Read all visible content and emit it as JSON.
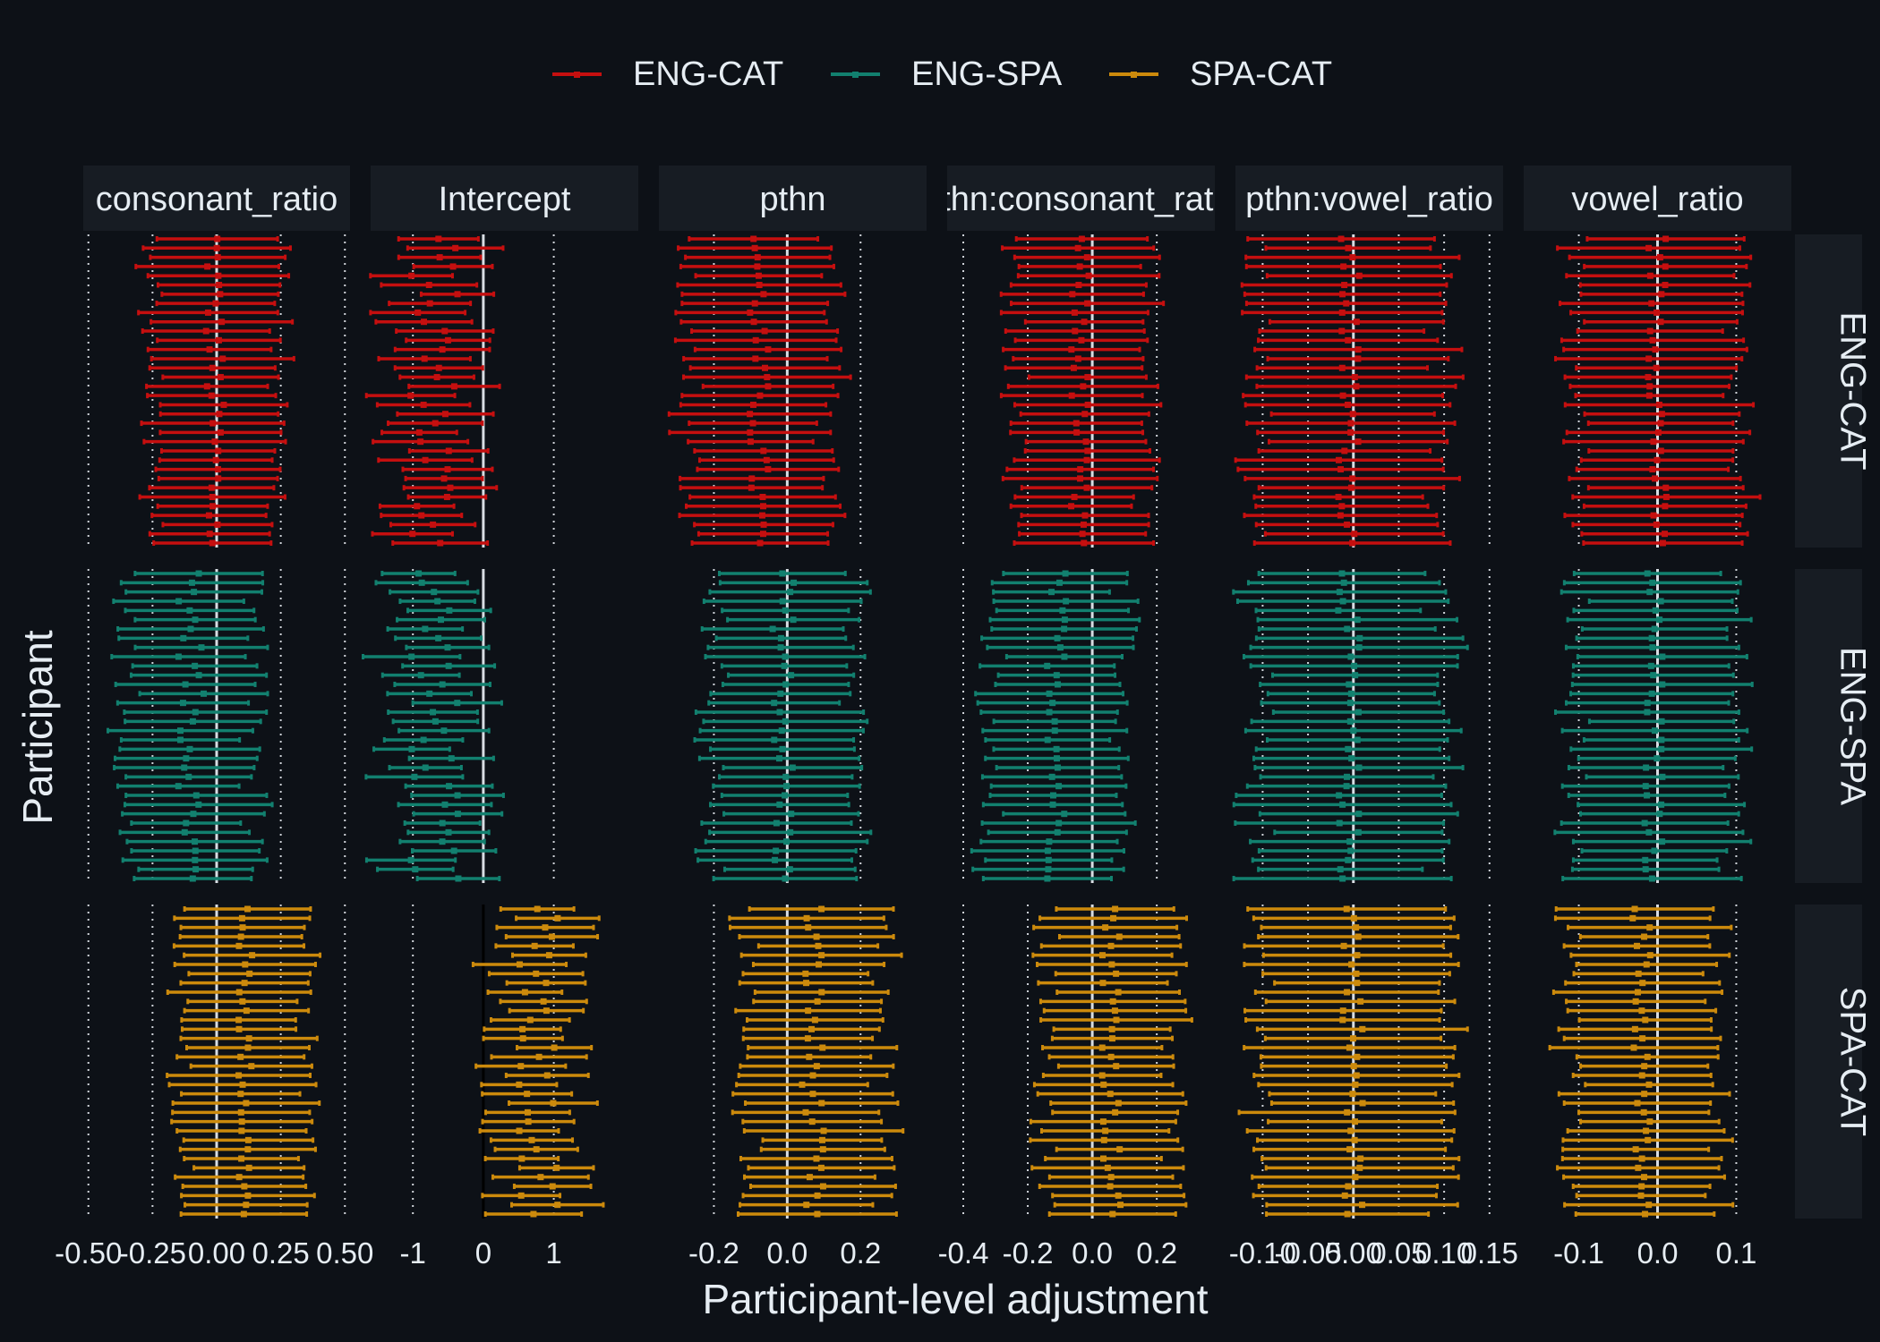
{
  "chart_data": {
    "type": "forest",
    "title": "",
    "xlabel": "Participant-level adjustment",
    "ylabel": "Participant",
    "legend": {
      "position": "top",
      "entries": [
        {
          "name": "ENG-CAT",
          "color": "#c50f0f"
        },
        {
          "name": "ENG-SPA",
          "color": "#12806f"
        },
        {
          "name": "SPA-CAT",
          "color": "#cc8a0c"
        }
      ]
    },
    "facet_columns": [
      {
        "label": "consonant_ratio",
        "xlim": [
          -0.52,
          0.52
        ],
        "ticks": [
          {
            "v": -0.5,
            "t": "-0.50"
          },
          {
            "v": -0.25,
            "t": "-0.25"
          },
          {
            "v": 0,
            "t": "0.00"
          },
          {
            "v": 0.25,
            "t": "0.25"
          },
          {
            "v": 0.5,
            "t": "0.50"
          }
        ],
        "rows": {
          "ENG-CAT": {
            "center": -0.01,
            "halfwidth": 0.25,
            "jitter": 0.04
          },
          "ENG-SPA": {
            "center": -0.1,
            "halfwidth": 0.25,
            "jitter": 0.05
          },
          "SPA-CAT": {
            "center": 0.11,
            "halfwidth": 0.25,
            "jitter": 0.03
          }
        }
      },
      {
        "label": "Intercept",
        "xlim": [
          -1.6,
          2.2
        ],
        "ticks": [
          {
            "v": -1,
            "t": "-1"
          },
          {
            "v": 0,
            "t": "0"
          },
          {
            "v": 1,
            "t": "1"
          }
        ],
        "rows": {
          "ENG-CAT": {
            "center": -0.7,
            "halfwidth": 0.6,
            "jitter": 0.35
          },
          "ENG-SPA": {
            "center": -0.7,
            "halfwidth": 0.6,
            "jitter": 0.35
          },
          "SPA-CAT": {
            "center": 0.8,
            "halfwidth": 0.6,
            "jitter": 0.3
          }
        }
      },
      {
        "label": "pthn",
        "xlim": [
          -0.35,
          0.38
        ],
        "ticks": [
          {
            "v": -0.2,
            "t": "-0.2"
          },
          {
            "v": 0,
            "t": "0.0"
          },
          {
            "v": 0.2,
            "t": "0.2"
          }
        ],
        "rows": {
          "ENG-CAT": {
            "center": -0.08,
            "halfwidth": 0.2,
            "jitter": 0.03
          },
          "ENG-SPA": {
            "center": -0.01,
            "halfwidth": 0.2,
            "jitter": 0.03
          },
          "SPA-CAT": {
            "center": 0.07,
            "halfwidth": 0.19,
            "jitter": 0.03
          }
        }
      },
      {
        "label": "pthn:consonant_ratio",
        "xlim": [
          -0.45,
          0.38
        ],
        "ticks": [
          {
            "v": -0.4,
            "t": "-0.4"
          },
          {
            "v": -0.2,
            "t": "-0.2"
          },
          {
            "v": 0,
            "t": "0.0"
          },
          {
            "v": 0.2,
            "t": "0.2"
          }
        ],
        "rows": {
          "ENG-CAT": {
            "center": -0.04,
            "halfwidth": 0.21,
            "jitter": 0.03
          },
          "ENG-SPA": {
            "center": -0.11,
            "halfwidth": 0.21,
            "jitter": 0.03
          },
          "SPA-CAT": {
            "center": 0.06,
            "halfwidth": 0.21,
            "jitter": 0.03
          }
        }
      },
      {
        "label": "pthn:vowel_ratio",
        "xlim": [
          -0.13,
          0.165
        ],
        "ticks": [
          {
            "v": -0.1,
            "t": "-0.10"
          },
          {
            "v": -0.05,
            "t": "-0.05"
          },
          {
            "v": 0,
            "t": "0.00"
          },
          {
            "v": 0.05,
            "t": "0.05"
          },
          {
            "v": 0.1,
            "t": "0.10"
          },
          {
            "v": 0.15,
            "t": "0.15"
          }
        ],
        "rows": {
          "ENG-CAT": {
            "center": -0.005,
            "halfwidth": 0.105,
            "jitter": 0.012
          },
          "ENG-SPA": {
            "center": -0.005,
            "halfwidth": 0.105,
            "jitter": 0.012
          },
          "SPA-CAT": {
            "center": 0.0,
            "halfwidth": 0.105,
            "jitter": 0.012
          }
        }
      },
      {
        "label": "vowel_ratio",
        "xlim": [
          -0.17,
          0.17
        ],
        "ticks": [
          {
            "v": -0.1,
            "t": "-0.1"
          },
          {
            "v": 0,
            "t": "0.0"
          },
          {
            "v": 0.1,
            "t": "0.1"
          }
        ],
        "rows": {
          "ENG-CAT": {
            "center": 0.0,
            "halfwidth": 0.105,
            "jitter": 0.012
          },
          "ENG-SPA": {
            "center": -0.005,
            "halfwidth": 0.105,
            "jitter": 0.012
          },
          "SPA-CAT": {
            "center": -0.02,
            "halfwidth": 0.095,
            "jitter": 0.012
          }
        }
      }
    ],
    "facet_rows": [
      "ENG-CAT",
      "ENG-SPA",
      "SPA-CAT"
    ],
    "participants_per_row": 34,
    "grid": true,
    "zero_line": true
  }
}
